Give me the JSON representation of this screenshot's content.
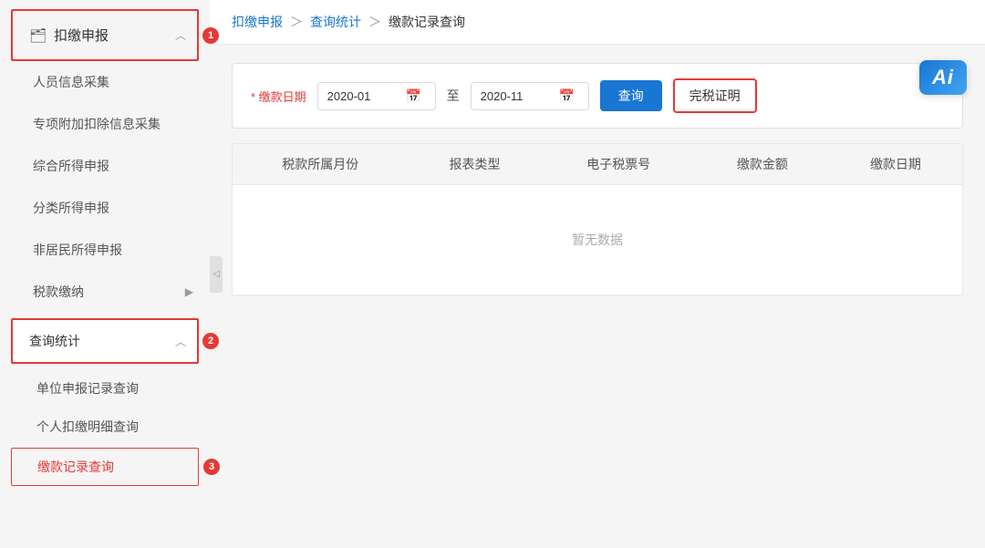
{
  "sidebar": {
    "main_menu_label": "扣缴申报",
    "main_menu_icon": "📋",
    "items": [
      {
        "id": "personnel",
        "label": "人员信息采集"
      },
      {
        "id": "special",
        "label": "专项附加扣除信息采集"
      },
      {
        "id": "comprehensive",
        "label": "综合所得申报"
      },
      {
        "id": "classified",
        "label": "分类所得申报"
      },
      {
        "id": "nonresident",
        "label": "非居民所得申报"
      },
      {
        "id": "taxpay",
        "label": "税款缴纳"
      }
    ],
    "section_query": {
      "label": "查询统计",
      "badge": "2"
    },
    "query_items": [
      {
        "id": "unit-query",
        "label": "单位申报记录查询"
      },
      {
        "id": "personal-detail",
        "label": "个人扣缴明细查询"
      },
      {
        "id": "payment-query",
        "label": "缴款记录查询",
        "active": true
      }
    ]
  },
  "breadcrumb": {
    "items": [
      {
        "id": "bc-main",
        "label": "扣缴申报"
      },
      {
        "id": "bc-query",
        "label": "查询统计"
      },
      {
        "id": "bc-current",
        "label": "缴款记录查询"
      }
    ]
  },
  "filter": {
    "date_label": "* 缴款日期",
    "date_from": "2020-01",
    "date_to": "2020-11",
    "date_placeholder_from": "2020-01",
    "date_placeholder_to": "2020-11",
    "range_sep": "至",
    "query_btn": "查询",
    "cert_btn": "完税证明"
  },
  "table": {
    "columns": [
      {
        "id": "col-month",
        "label": "税款所属月份"
      },
      {
        "id": "col-type",
        "label": "报表类型"
      },
      {
        "id": "col-ticket",
        "label": "电子税票号"
      },
      {
        "id": "col-amount",
        "label": "缴款金额"
      },
      {
        "id": "col-date",
        "label": "缴款日期"
      }
    ],
    "empty_text": "暂无数据"
  },
  "ai_badge": "Ai",
  "badge_numbers": {
    "main": "1",
    "section": "2",
    "active_item": "3"
  }
}
